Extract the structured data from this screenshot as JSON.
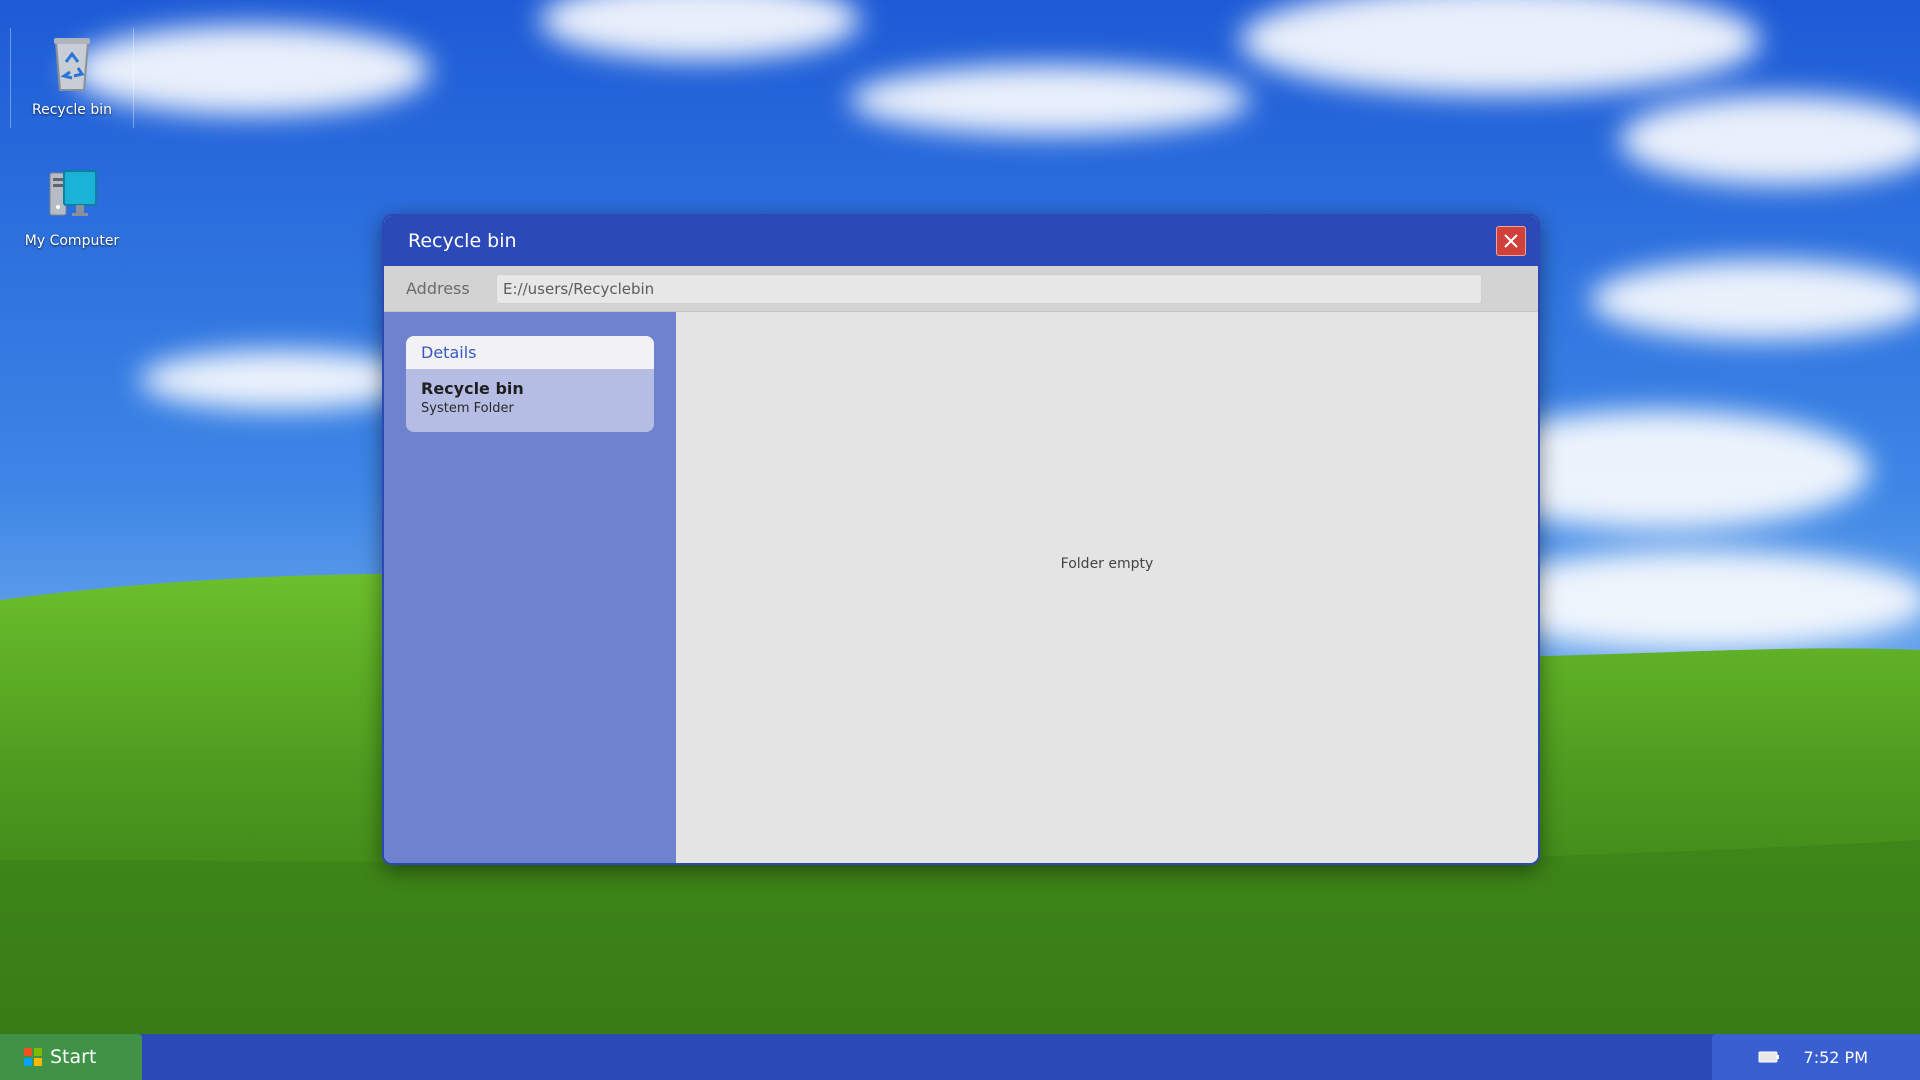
{
  "desktop": {
    "icons": [
      {
        "label": "Recycle bin",
        "icon": "recycle-bin-icon"
      },
      {
        "label": "My Computer",
        "icon": "computer-icon"
      }
    ]
  },
  "window": {
    "title": "Recycle bin",
    "close_icon": "close-icon",
    "address": {
      "label": "Address",
      "value": "E://users/Recyclebin"
    },
    "details": {
      "header": "Details",
      "name": "Recycle bin",
      "type": "System Folder"
    },
    "main": {
      "empty_message": "Folder empty"
    }
  },
  "taskbar": {
    "start_label": "Start",
    "clock": "7:52 PM",
    "tray_icon": "battery-icon"
  },
  "colors": {
    "titlebar": "#2b49b7",
    "close_button": "#d1413b",
    "sidebar": "#6f82cf",
    "start_button": "#3f9246",
    "taskbar": "#2b49b7"
  }
}
